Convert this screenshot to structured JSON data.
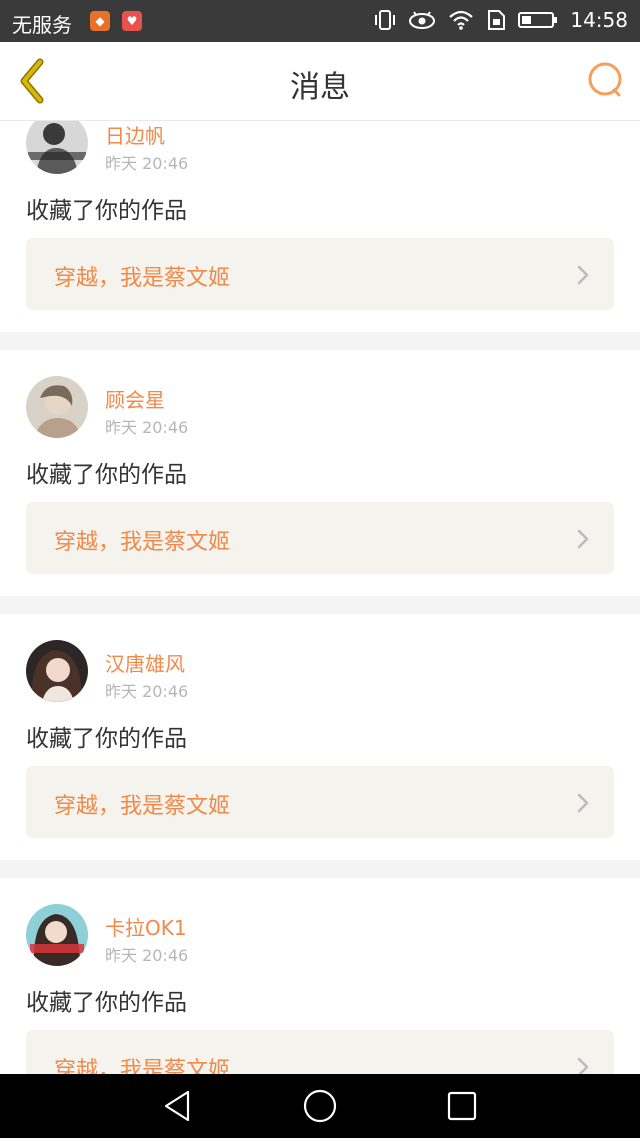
{
  "status_bar": {
    "carrier": "无服务",
    "time": "14:58",
    "icons": [
      "vibrate-icon",
      "eye-icon",
      "wifi-icon",
      "sim-icon",
      "battery-icon"
    ]
  },
  "nav": {
    "title": "消息",
    "back_icon": "chevron-left-icon",
    "search_icon": "search-icon"
  },
  "colors": {
    "accent": "#f08a4b",
    "back": "#c8a300",
    "card_bg": "#f4f3ee"
  },
  "messages": [
    {
      "user": "日边帆",
      "time": "昨天 20:46",
      "action": "收藏了你的作品",
      "work_title": "穿越，我是蔡文姬"
    },
    {
      "user": "顾会星",
      "time": "昨天 20:46",
      "action": "收藏了你的作品",
      "work_title": "穿越，我是蔡文姬"
    },
    {
      "user": "汉唐雄风",
      "time": "昨天 20:46",
      "action": "收藏了你的作品",
      "work_title": "穿越，我是蔡文姬"
    },
    {
      "user": "卡拉OK1",
      "time": "昨天 20:46",
      "action": "收藏了你的作品",
      "work_title": "穿越，我是蔡文姬"
    }
  ],
  "system_nav": [
    "back-triangle-icon",
    "home-circle-icon",
    "recents-square-icon"
  ]
}
